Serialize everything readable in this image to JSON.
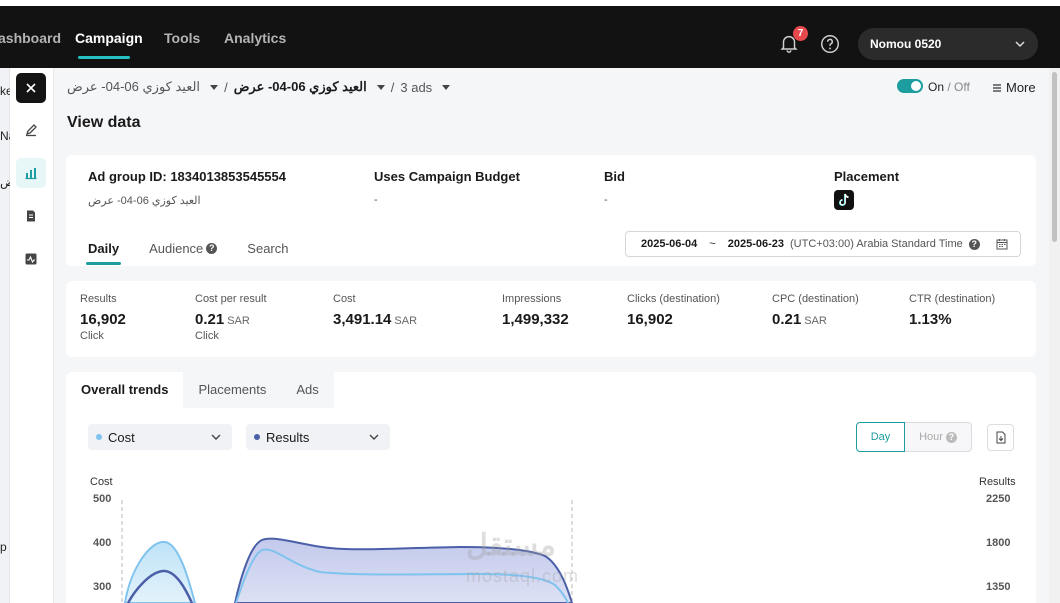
{
  "nav": {
    "items": [
      "ashboard",
      "Campaign",
      "Tools",
      "Analytics"
    ],
    "notification_count": "7",
    "account_name": "Nomou 0520"
  },
  "left_fragments": [
    "ke",
    "Na",
    "ض",
    "p"
  ],
  "breadcrumb": {
    "campaign": "العيد كوزي 06-04- عرض",
    "ad_group": "العيد كوزي 06-04- عرض",
    "ads": "3 ads"
  },
  "status": {
    "on": "On",
    "off": "Off",
    "more": "More"
  },
  "page_title": "View data",
  "info": {
    "ad_group_id_label": "Ad group ID: 1834013853545554",
    "ad_group_name": "العيد كوزي 06-04- عرض",
    "budget_label": "Uses Campaign Budget",
    "budget_value": "-",
    "bid_label": "Bid",
    "bid_value": "-",
    "placement_label": "Placement",
    "placement_icon": "tiktok-icon"
  },
  "detail_tabs": [
    "Daily",
    "Audience",
    "Search"
  ],
  "date_range": {
    "start": "2025-06-04",
    "separator": "~",
    "end": "2025-06-23",
    "timezone": "(UTC+03:00) Arabia Standard Time"
  },
  "metrics": [
    {
      "label": "Results",
      "value": "16,902",
      "unit": "",
      "sub": "Click"
    },
    {
      "label": "Cost per result",
      "value": "0.21",
      "unit": "SAR",
      "sub": "Click"
    },
    {
      "label": "Cost",
      "value": "3,491.14",
      "unit": "SAR",
      "sub": ""
    },
    {
      "label": "Impressions",
      "value": "1,499,332",
      "unit": "",
      "sub": ""
    },
    {
      "label": "Clicks (destination)",
      "value": "16,902",
      "unit": "",
      "sub": ""
    },
    {
      "label": "CPC (destination)",
      "value": "0.21",
      "unit": "SAR",
      "sub": ""
    },
    {
      "label": "CTR (destination)",
      "value": "1.13%",
      "unit": "",
      "sub": ""
    }
  ],
  "trend_tabs": [
    "Overall trends",
    "Placements",
    "Ads"
  ],
  "selectors": {
    "left": {
      "label": "Cost",
      "color": "#7fc3ee"
    },
    "right": {
      "label": "Results",
      "color": "#4a5fa8"
    }
  },
  "granularity": {
    "day": "Day",
    "hour": "Hour"
  },
  "watermark": {
    "main": "مستقل",
    "sub": "mostaql.com"
  },
  "chart_data": {
    "type": "area",
    "left_axis_title": "Cost",
    "right_axis_title": "Results",
    "left_ticks": [
      "500",
      "400",
      "300"
    ],
    "right_ticks": [
      "2250",
      "1800",
      "1350"
    ],
    "left_ylim": [
      300,
      500
    ],
    "right_ylim": [
      1350,
      2250
    ],
    "colors": {
      "cost": "#7fc3ee",
      "results": "#4a5fa8"
    }
  }
}
